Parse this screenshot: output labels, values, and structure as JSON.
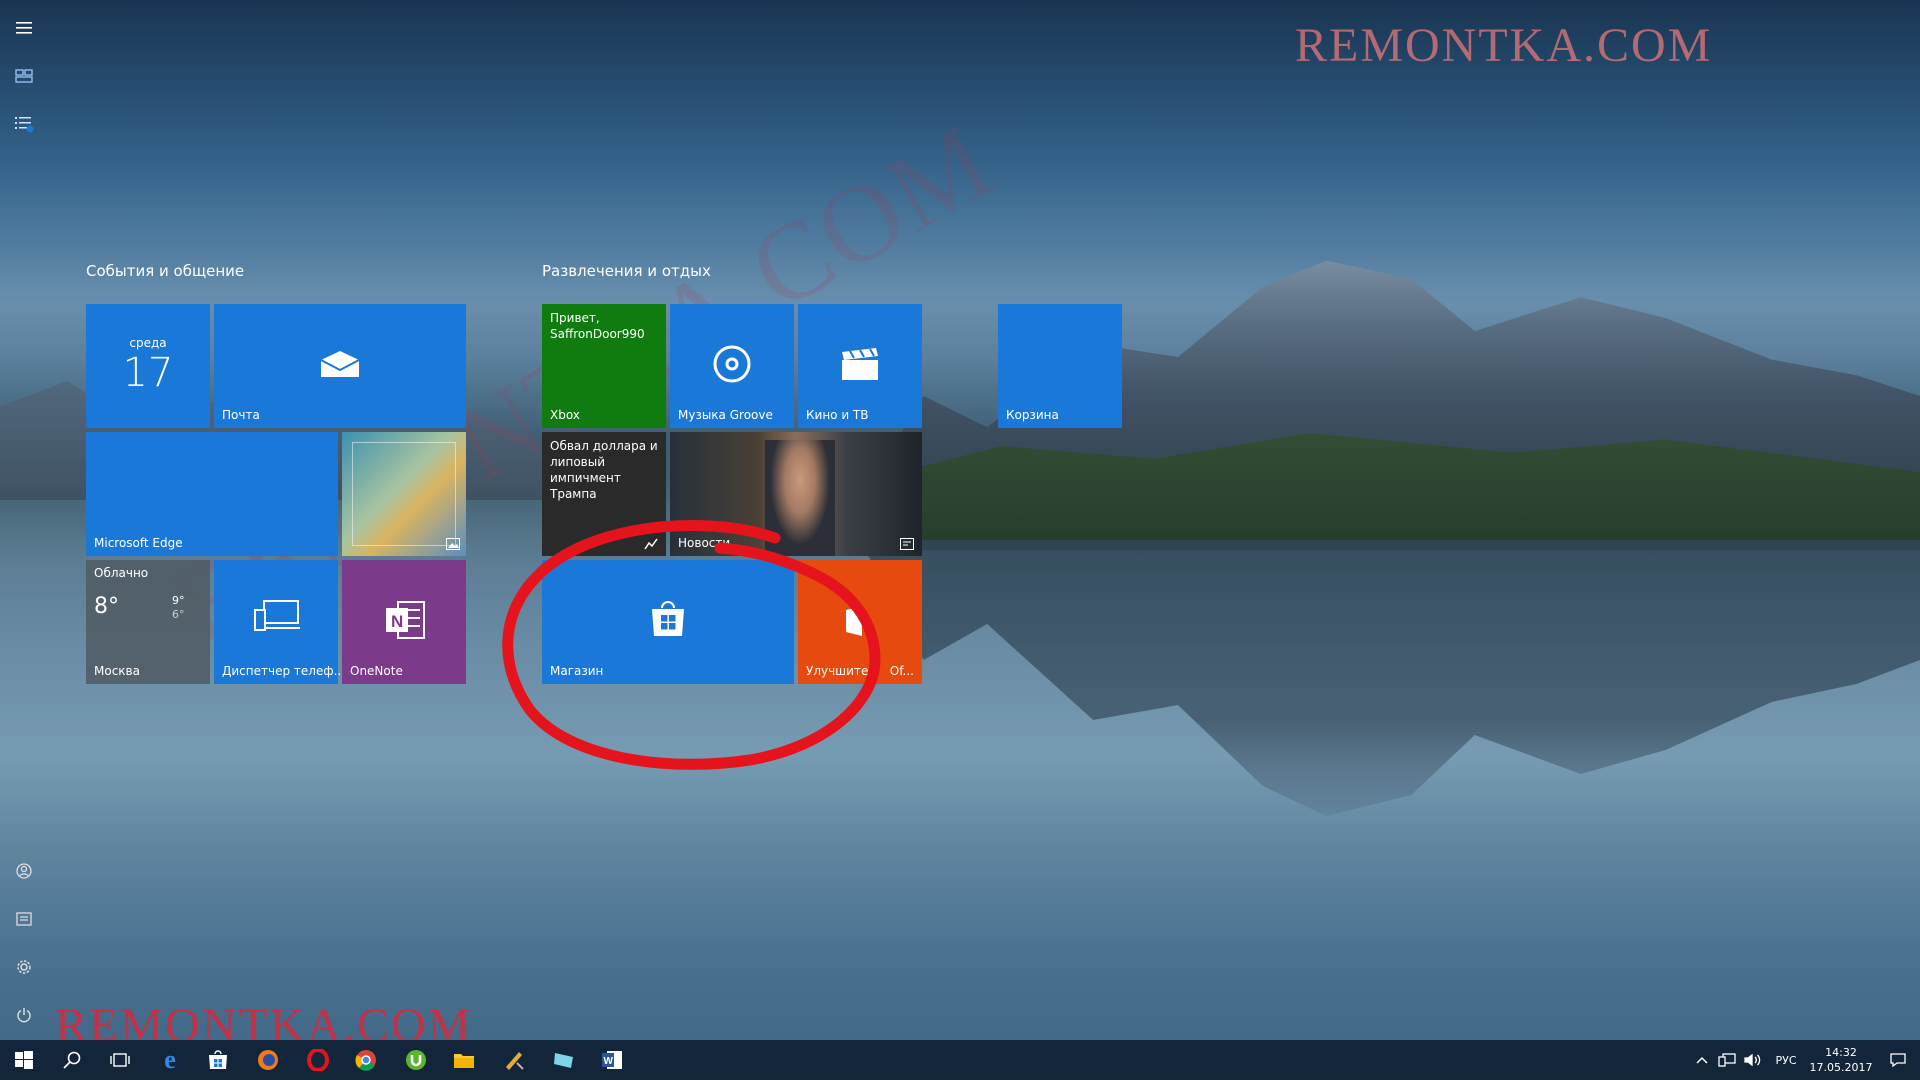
{
  "start_rail": {
    "items": [
      "menu-icon",
      "all-apps-icon",
      "list-icon",
      "user-icon",
      "documents-icon",
      "settings-icon",
      "power-icon"
    ]
  },
  "groups": [
    {
      "title": "События и общение"
    },
    {
      "title": "Развлечения и отдых"
    }
  ],
  "tiles": {
    "calendar": {
      "day": "среда",
      "date": "17"
    },
    "mail": {
      "label": "Почта"
    },
    "edge": {
      "label": "Microsoft Edge"
    },
    "weather": {
      "condition": "Облачно",
      "temp": "8°",
      "high": "9°",
      "low": "6°",
      "city": "Москва"
    },
    "phone": {
      "label": "Диспетчер телеф..."
    },
    "onenote": {
      "label": "OneNote"
    },
    "xbox": {
      "greeting": "Привет, SaffronDoor990",
      "label": "Xbox"
    },
    "groove": {
      "label": "Музыка Groove"
    },
    "movies": {
      "label": "Кино и ТВ"
    },
    "recycle": {
      "label": "Корзина"
    },
    "money": {
      "headline": "Обвал доллара и липовый импичмент Трампа"
    },
    "news": {
      "label": "Новости"
    },
    "store": {
      "label": "Магазин"
    },
    "office": {
      "label_left": "Улучшите",
      "label_right": "Of..."
    }
  },
  "colors": {
    "tile_blue": "#1a79d8",
    "xbox_green": "#107c10",
    "onenote_purple": "#7c3a8a",
    "office_orange": "#e64a0f",
    "highlight_red": "#e5141c"
  },
  "taskbar": {
    "apps": [
      "start-icon",
      "search-icon",
      "task-view-icon",
      "edge-icon",
      "store-icon",
      "firefox-icon",
      "opera-icon",
      "chrome-icon",
      "utorrent-icon",
      "explorer-icon",
      "app-icon",
      "mail-app-icon",
      "word-icon"
    ],
    "lang": "РУС",
    "time": "14:32",
    "date": "17.05.2017"
  },
  "watermark": {
    "text": "REMONTKA.COM"
  }
}
